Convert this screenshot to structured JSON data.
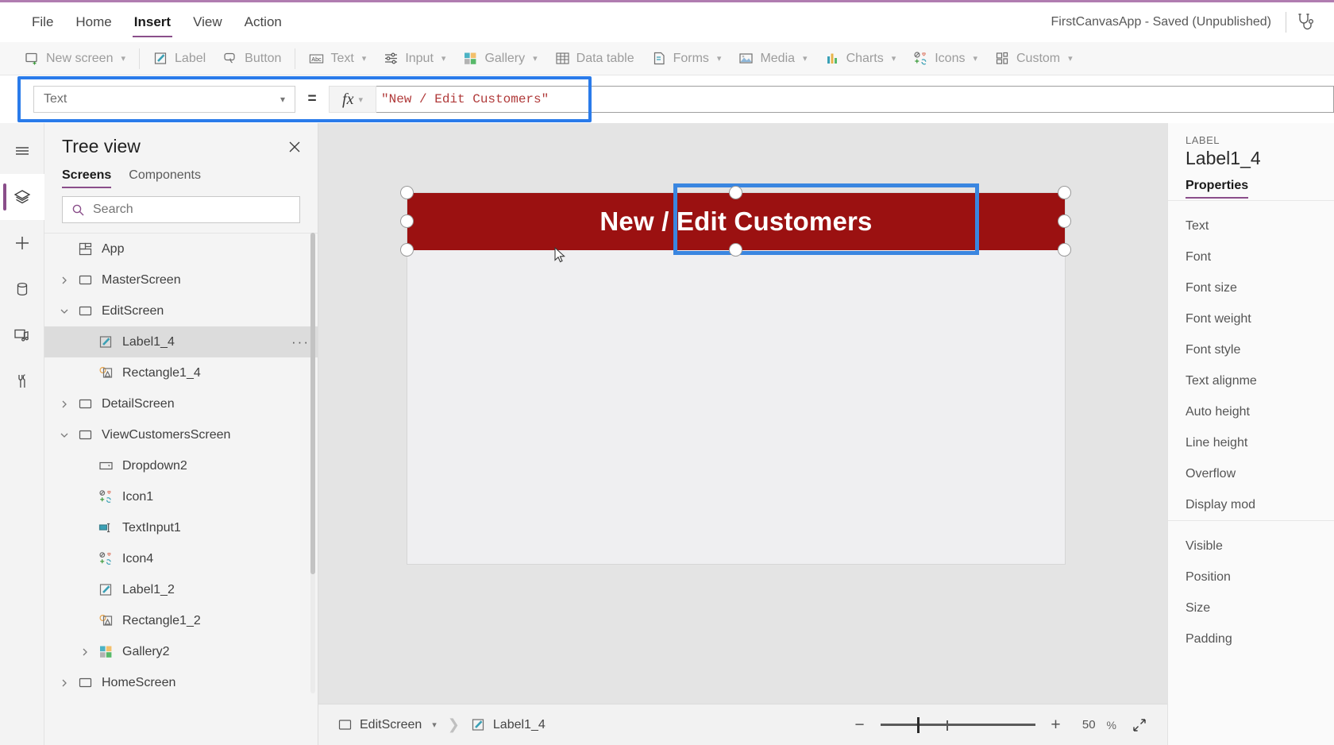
{
  "menubar": {
    "items": [
      {
        "label": "File",
        "active": false
      },
      {
        "label": "Home",
        "active": false
      },
      {
        "label": "Insert",
        "active": true
      },
      {
        "label": "View",
        "active": false
      },
      {
        "label": "Action",
        "active": false
      }
    ],
    "app_title": "FirstCanvasApp - Saved (Unpublished)",
    "app_checker_icon": "stethoscope-icon"
  },
  "ribbon": {
    "items": [
      {
        "label": "New screen",
        "icon": "new-screen-icon",
        "caret": true
      },
      {
        "label": "Label",
        "icon": "label-icon",
        "caret": false
      },
      {
        "label": "Button",
        "icon": "button-icon",
        "caret": false
      },
      {
        "label": "Text",
        "icon": "text-abc-icon",
        "caret": true
      },
      {
        "label": "Input",
        "icon": "input-sliders-icon",
        "caret": true
      },
      {
        "label": "Gallery",
        "icon": "gallery-grid-icon",
        "caret": true
      },
      {
        "label": "Data table",
        "icon": "data-table-icon",
        "caret": false
      },
      {
        "label": "Forms",
        "icon": "forms-icon",
        "caret": true
      },
      {
        "label": "Media",
        "icon": "media-image-icon",
        "caret": true
      },
      {
        "label": "Charts",
        "icon": "charts-bar-icon",
        "caret": true
      },
      {
        "label": "Icons",
        "icon": "icons-set-icon",
        "caret": true
      },
      {
        "label": "Custom",
        "icon": "custom-blocks-icon",
        "caret": true
      }
    ]
  },
  "formula_bar": {
    "property_selected": "Text",
    "equals": "=",
    "fx_label": "fx",
    "value": "\"New / Edit Customers\"",
    "highlight_color": "#2a7bea",
    "value_color": "#b03a3a"
  },
  "rail": {
    "items": [
      {
        "icon": "hamburger-menu-icon",
        "active": false
      },
      {
        "icon": "tree-view-layers-icon",
        "active": true
      },
      {
        "icon": "insert-plus-icon",
        "active": false
      },
      {
        "icon": "data-cylinder-icon",
        "active": false
      },
      {
        "icon": "media-library-icon",
        "active": false
      },
      {
        "icon": "advanced-tools-icon",
        "active": false
      }
    ],
    "accent": "#8a4e8a"
  },
  "treeview": {
    "title": "Tree view",
    "close_icon": "close-icon",
    "tabs": [
      {
        "label": "Screens",
        "active": true
      },
      {
        "label": "Components",
        "active": false
      }
    ],
    "search_placeholder": "Search",
    "search_value": "",
    "search_icon": "search-icon",
    "nodes": [
      {
        "label": "App",
        "icon": "app-icon",
        "indent": 0,
        "twisty": "none",
        "selected": false,
        "menu": false
      },
      {
        "label": "MasterScreen",
        "icon": "screen-icon",
        "indent": 0,
        "twisty": "collapsed",
        "selected": false,
        "menu": false
      },
      {
        "label": "EditScreen",
        "icon": "screen-icon",
        "indent": 0,
        "twisty": "expanded",
        "selected": false,
        "menu": false
      },
      {
        "label": "Label1_4",
        "icon": "label-icon",
        "indent": 1,
        "twisty": "none",
        "selected": true,
        "menu": true
      },
      {
        "label": "Rectangle1_4",
        "icon": "shape-icon",
        "indent": 1,
        "twisty": "none",
        "selected": false,
        "menu": false
      },
      {
        "label": "DetailScreen",
        "icon": "screen-icon",
        "indent": 0,
        "twisty": "collapsed",
        "selected": false,
        "menu": false
      },
      {
        "label": "ViewCustomersScreen",
        "icon": "screen-icon",
        "indent": 0,
        "twisty": "expanded",
        "selected": false,
        "menu": false
      },
      {
        "label": "Dropdown2",
        "icon": "dropdown-icon",
        "indent": 1,
        "twisty": "none",
        "selected": false,
        "menu": false
      },
      {
        "label": "Icon1",
        "icon": "icons-set-icon",
        "indent": 1,
        "twisty": "none",
        "selected": false,
        "menu": false
      },
      {
        "label": "TextInput1",
        "icon": "text-input-icon",
        "indent": 1,
        "twisty": "none",
        "selected": false,
        "menu": false
      },
      {
        "label": "Icon4",
        "icon": "icons-set-icon",
        "indent": 1,
        "twisty": "none",
        "selected": false,
        "menu": false
      },
      {
        "label": "Label1_2",
        "icon": "label-icon",
        "indent": 1,
        "twisty": "none",
        "selected": false,
        "menu": false
      },
      {
        "label": "Rectangle1_2",
        "icon": "shape-icon",
        "indent": 1,
        "twisty": "none",
        "selected": false,
        "menu": false
      },
      {
        "label": "Gallery2",
        "icon": "gallery-grid-icon",
        "indent": 1,
        "twisty": "collapsed",
        "selected": false,
        "menu": false
      },
      {
        "label": "HomeScreen",
        "icon": "screen-icon",
        "indent": 0,
        "twisty": "collapsed",
        "selected": false,
        "menu": false
      }
    ]
  },
  "canvas": {
    "banner_text": "New / Edit Customers",
    "banner_color": "#9b1111",
    "screen_background": "#efeff1",
    "selection_color": "#3a86e0",
    "cursor_icon": "mouse-pointer-icon"
  },
  "statusbar": {
    "screen_crumb": "EditScreen",
    "screen_icon": "screen-icon",
    "control_crumb": "Label1_4",
    "control_icon": "label-icon",
    "zoom_out_label": "−",
    "zoom_in_label": "+",
    "zoom_value": "50",
    "zoom_unit": "%",
    "fit_icon": "fit-to-screen-icon"
  },
  "properties": {
    "kind": "LABEL",
    "name": "Label1_4",
    "tab": "Properties",
    "group1": [
      "Text",
      "Font",
      "Font size",
      "Font weight",
      "Font style",
      "Text alignme",
      "Auto height",
      "Line height",
      "Overflow",
      "Display mod"
    ],
    "group2": [
      "Visible",
      "Position",
      "Size",
      "Padding"
    ]
  }
}
